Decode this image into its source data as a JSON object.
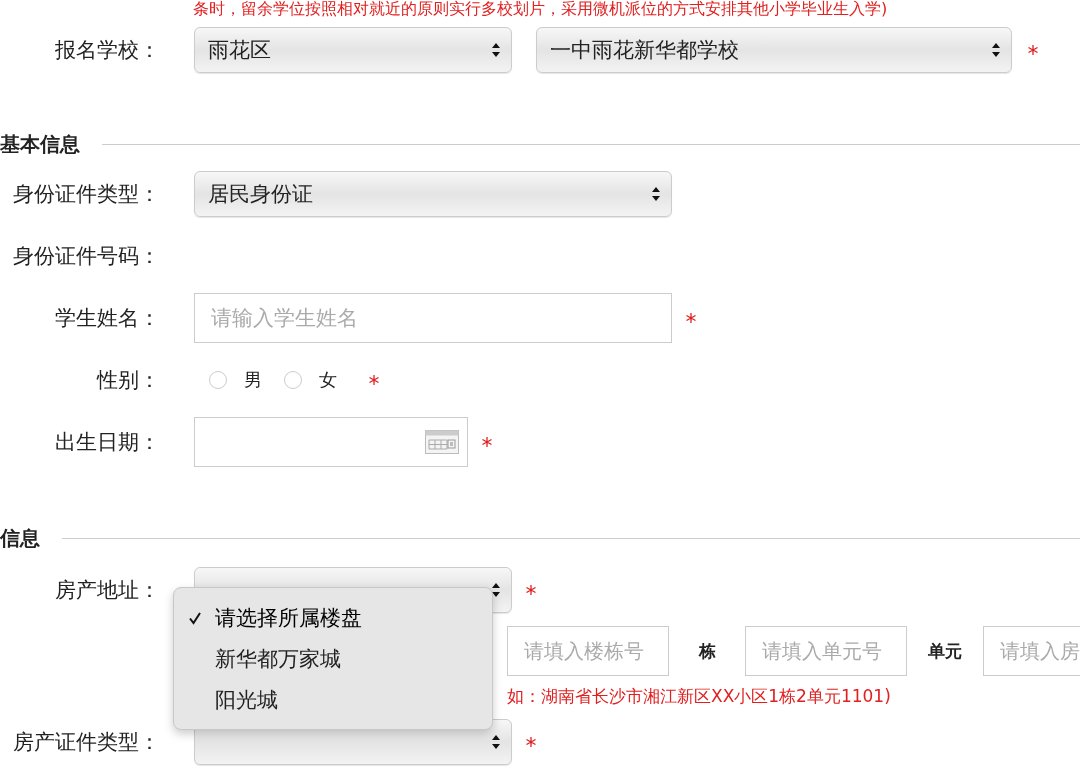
{
  "notice": "条时，留余学位按照相对就近的原则实行多校划片，采用微机派位的方式安排其他小学毕业生入学)",
  "school": {
    "label": "报名学校：",
    "selects": [
      {
        "value": "雨花区"
      },
      {
        "value": "一中雨花新华都学校"
      }
    ],
    "required": true
  },
  "sections": [
    {
      "title": "基本信息",
      "fields": [
        {
          "kind": "select",
          "label": "身份证件类型：",
          "value": "居民身份证",
          "required": false
        },
        {
          "kind": "text",
          "label": "身份证件号码：",
          "required": false
        },
        {
          "kind": "input",
          "label": "学生姓名：",
          "placeholder": "请输入学生姓名",
          "required": true
        },
        {
          "kind": "radio",
          "label": "性别：",
          "options": [
            {
              "label": "男",
              "selected": false
            },
            {
              "label": "女",
              "selected": false
            }
          ],
          "required": true
        },
        {
          "kind": "date",
          "label": "出生日期：",
          "required": true
        }
      ]
    },
    {
      "title": "信息",
      "fields": [
        {
          "kind": "select",
          "label": "房产地址：",
          "required": true
        },
        {
          "kind": "address",
          "parts": [
            {
              "placeholder": "请填入楼栋号",
              "unit": "栋"
            },
            {
              "placeholder": "请填入单元号",
              "unit": "单元"
            },
            {
              "placeholder": "请填入房"
            }
          ]
        },
        {
          "kind": "note",
          "text": "如：湖南省长沙市湘江新区XX小区1栋2单元1101)"
        },
        {
          "kind": "select",
          "label": "房产证件类型：",
          "required": true
        }
      ]
    }
  ],
  "dropdown": {
    "options": [
      {
        "label": "请选择所属楼盘",
        "selected": true
      },
      {
        "label": "新华都万家城",
        "selected": false
      },
      {
        "label": "阳光城",
        "selected": false
      }
    ]
  }
}
